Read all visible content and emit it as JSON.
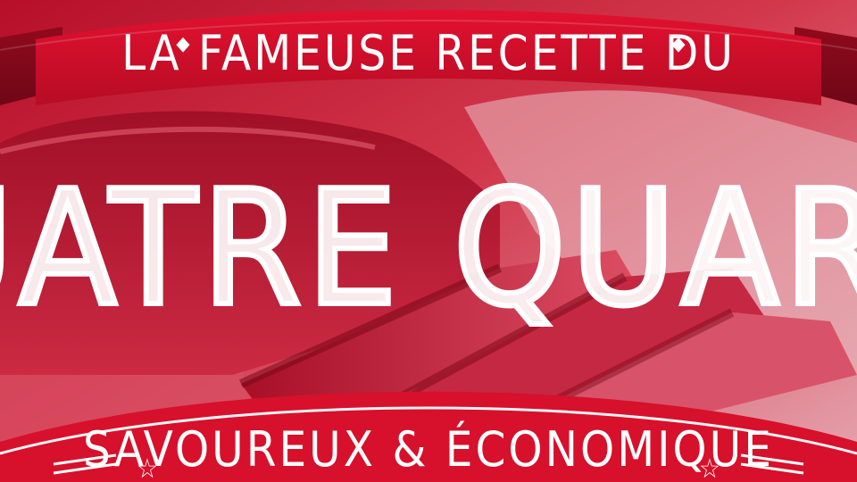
{
  "banner": {
    "top_text": "LA FAMEUSE RECETTE DU",
    "ornament": "◆"
  },
  "headline": {
    "text": "QUATRE QUARTS"
  },
  "bottom_banner": {
    "text": "SAVOUREUX & ÉCONOMIQUE",
    "ornament": "☆"
  },
  "colors": {
    "primary_red": "#d7102b",
    "dark_red": "#9c0a1f",
    "overlay": "#d61a3a",
    "text": "#ffffff"
  }
}
